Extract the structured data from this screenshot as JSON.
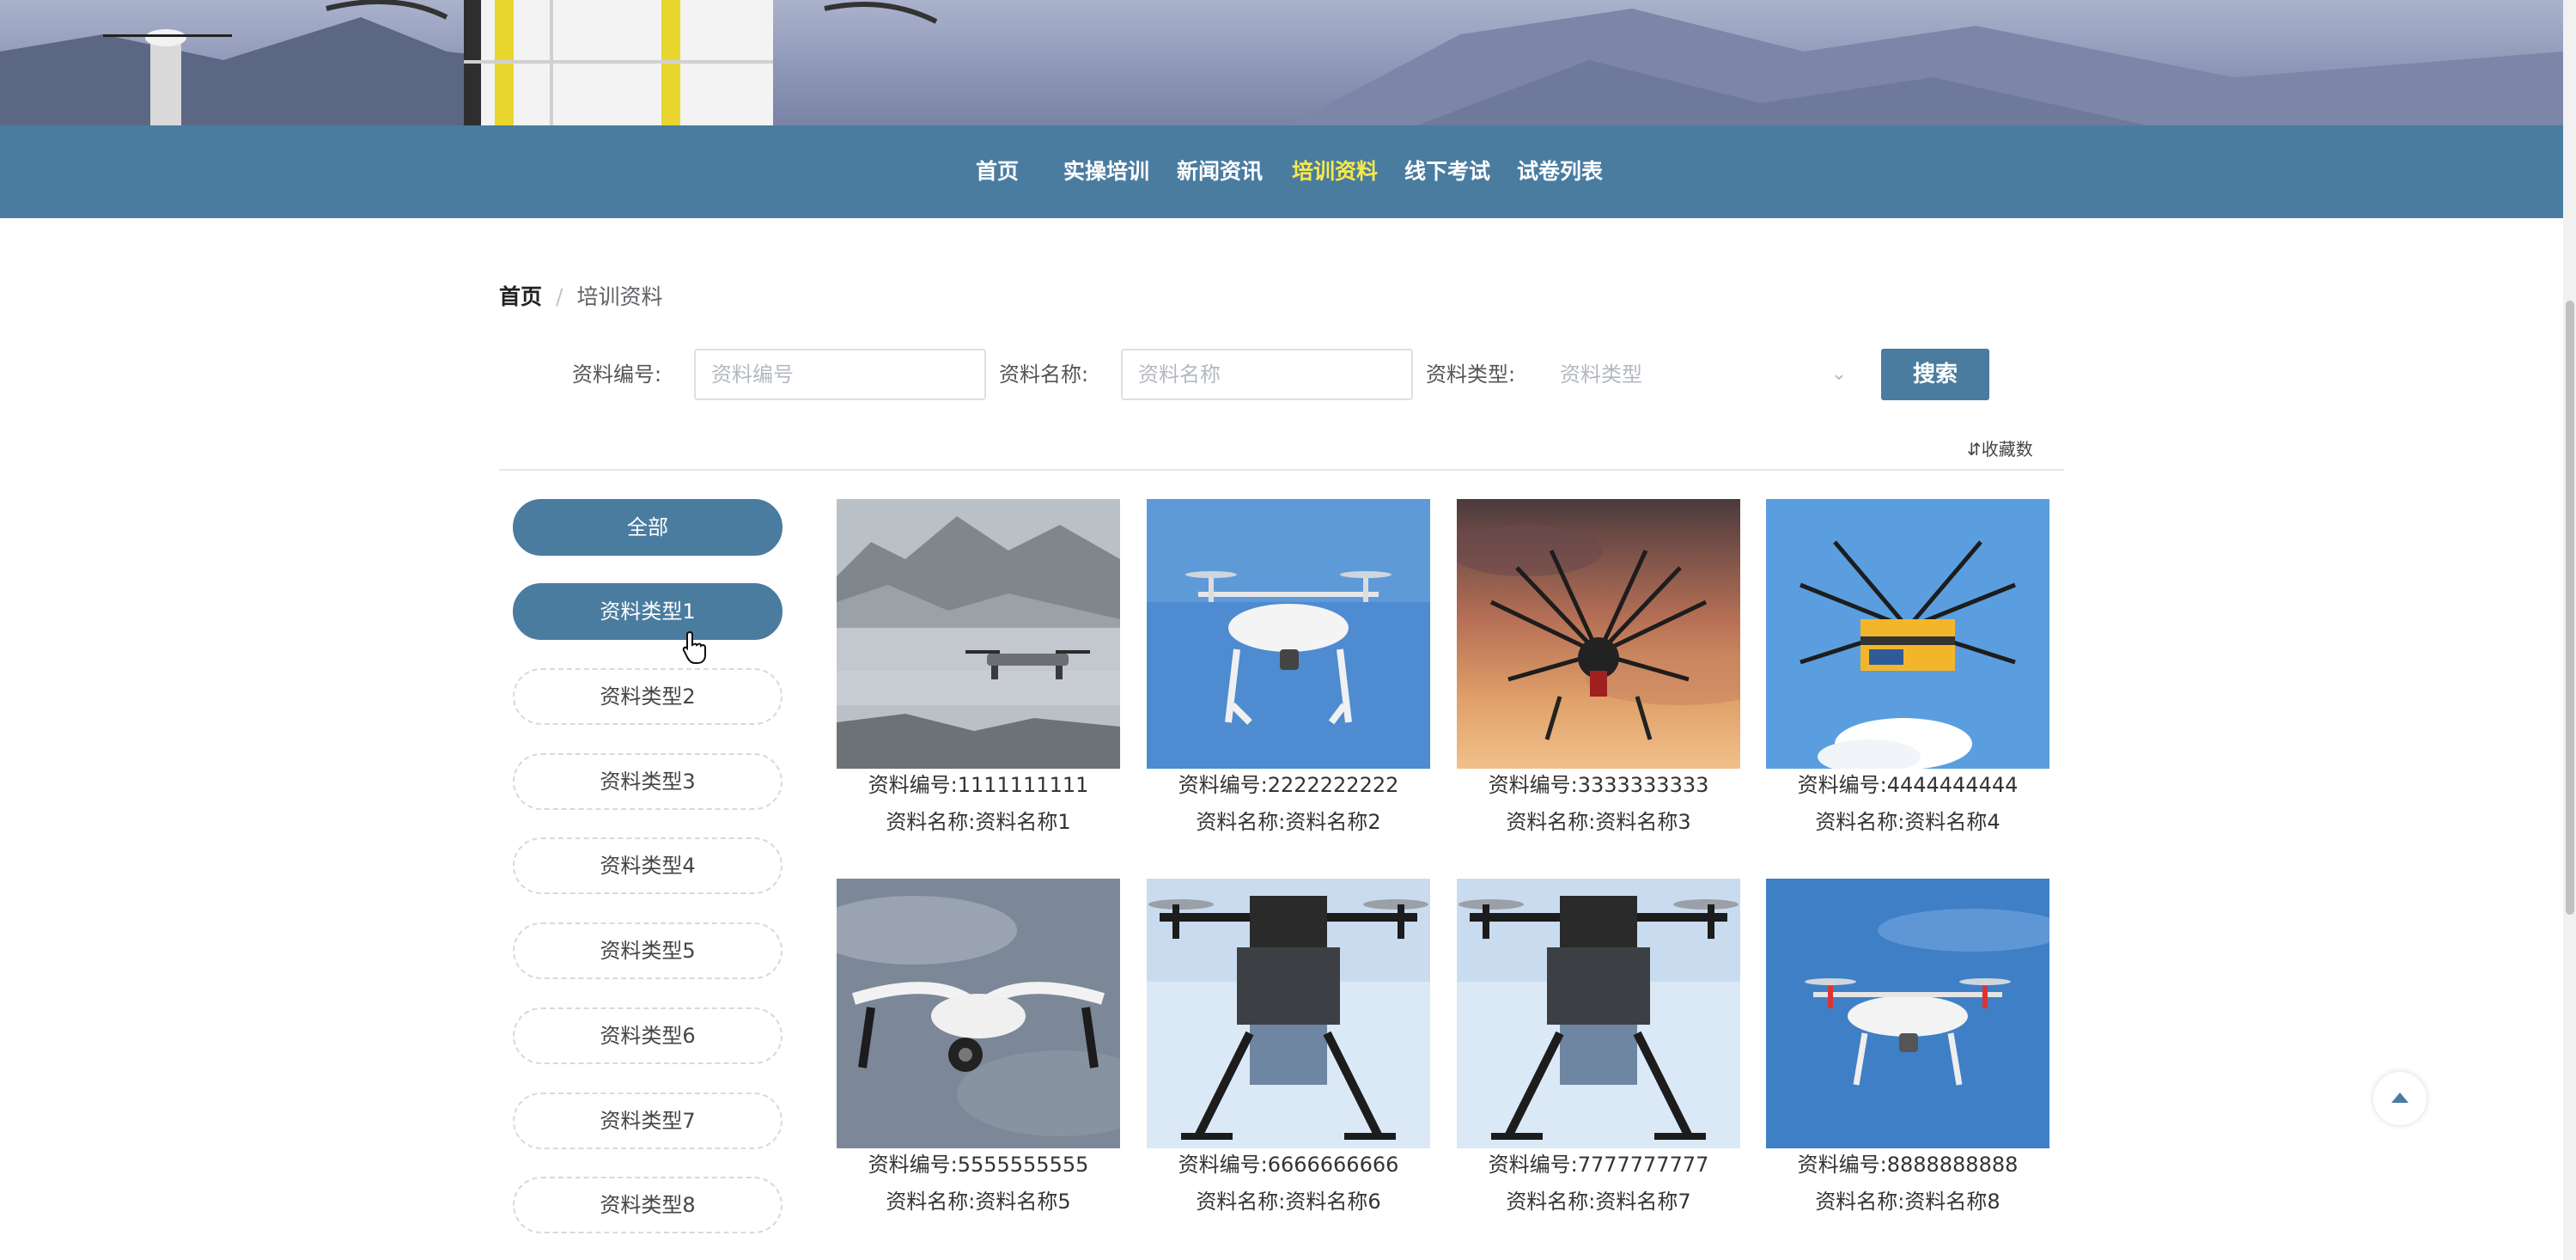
{
  "nav": {
    "items": [
      {
        "label": "首页",
        "active": false
      },
      {
        "label": "实操培训",
        "active": false
      },
      {
        "label": "新闻资讯",
        "active": false
      },
      {
        "label": "培训资料",
        "active": true
      },
      {
        "label": "线下考试",
        "active": false
      },
      {
        "label": "试卷列表",
        "active": false
      }
    ]
  },
  "breadcrumb": {
    "home": "首页",
    "separator": "/",
    "current": "培训资料"
  },
  "search": {
    "code_label": "资料编号:",
    "code_placeholder": "资料编号",
    "name_label": "资料名称:",
    "name_placeholder": "资料名称",
    "type_label": "资料类型:",
    "type_placeholder": "资料类型",
    "button": "搜索"
  },
  "sort_label": "收藏数",
  "categories": [
    {
      "label": "全部",
      "active": true
    },
    {
      "label": "资料类型1",
      "active": true
    },
    {
      "label": "资料类型2",
      "active": false
    },
    {
      "label": "资料类型3",
      "active": false
    },
    {
      "label": "资料类型4",
      "active": false
    },
    {
      "label": "资料类型5",
      "active": false
    },
    {
      "label": "资料类型6",
      "active": false
    },
    {
      "label": "资料类型7",
      "active": false
    },
    {
      "label": "资料类型8",
      "active": false
    }
  ],
  "cards": [
    {
      "code_label": "资料编号:",
      "code": "1111111111",
      "name_label": "资料名称:",
      "name": "资料名称1",
      "image": "drone-over-misty-mountains"
    },
    {
      "code_label": "资料编号:",
      "code": "2222222222",
      "name_label": "资料名称:",
      "name": "资料名称2",
      "image": "white-quadcopter-blue-sky"
    },
    {
      "code_label": "资料编号:",
      "code": "3333333333",
      "name_label": "资料名称:",
      "name": "资料名称3",
      "image": "octocopter-sunset"
    },
    {
      "code_label": "资料编号:",
      "code": "4444444444",
      "name_label": "资料名称:",
      "name": "资料名称4",
      "image": "cargo-drone-blue-sky"
    },
    {
      "code_label": "资料编号:",
      "code": "5555555555",
      "name_label": "资料名称:",
      "name": "资料名称5",
      "image": "quadcopter-cloudy-sky"
    },
    {
      "code_label": "资料编号:",
      "code": "6666666666",
      "name_label": "资料名称:",
      "name": "资料名称6",
      "image": "spray-drone"
    },
    {
      "code_label": "资料编号:",
      "code": "7777777777",
      "name_label": "资料名称:",
      "name": "资料名称7",
      "image": "spray-drone"
    },
    {
      "code_label": "资料编号:",
      "code": "8888888888",
      "name_label": "资料名称:",
      "name": "资料名称8",
      "image": "white-quadcopter-blue-sky"
    }
  ],
  "colors": {
    "primary": "#4a7ca0",
    "nav_active": "#f5e94b"
  }
}
